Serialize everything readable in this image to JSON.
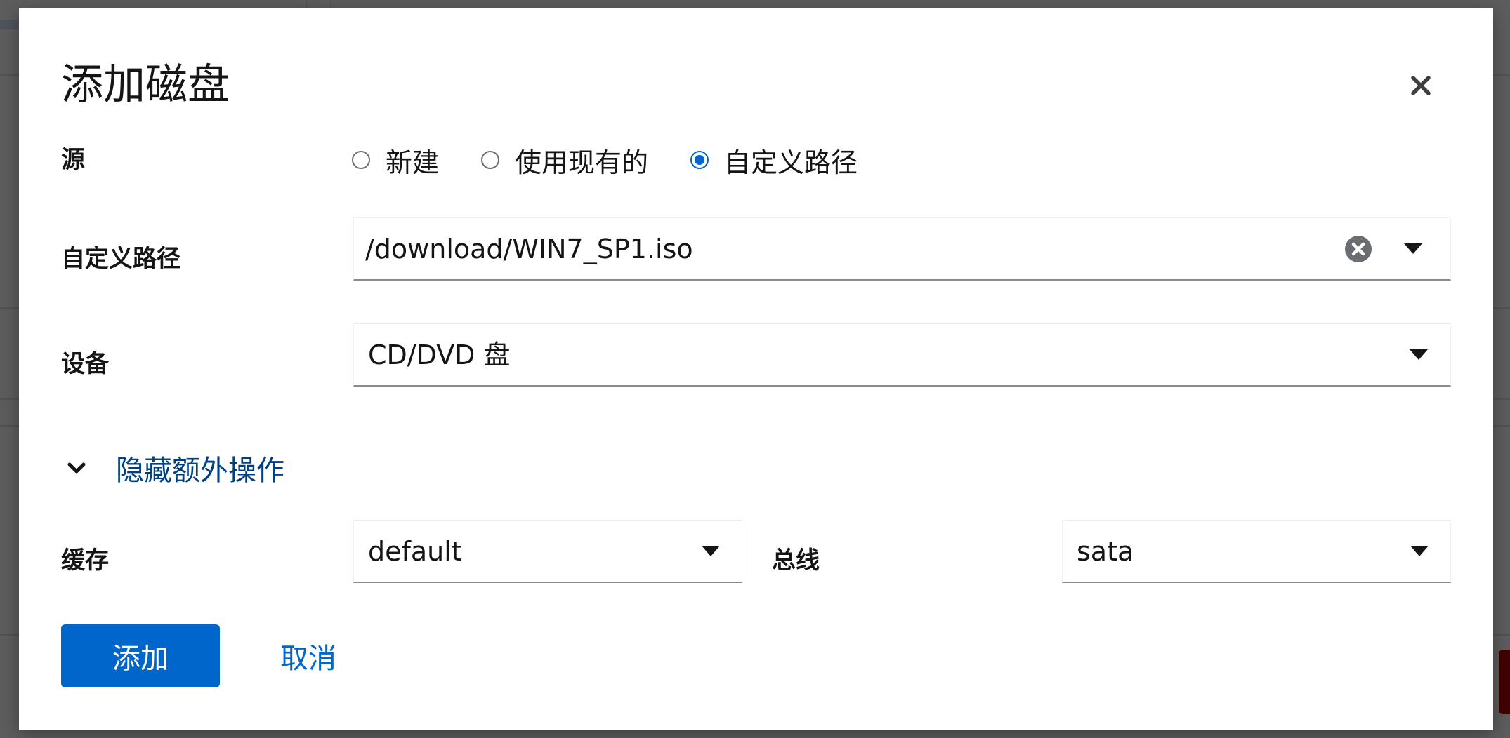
{
  "dialog": {
    "title": "添加磁盘"
  },
  "form": {
    "source": {
      "label": "源",
      "options": [
        {
          "label": "新建",
          "selected": false
        },
        {
          "label": "使用现有的",
          "selected": false
        },
        {
          "label": "自定义路径",
          "selected": true
        }
      ]
    },
    "custom_path": {
      "label": "自定义路径",
      "value": "/download/WIN7_SP1.iso"
    },
    "device": {
      "label": "设备",
      "value": "CD/DVD 盘"
    },
    "extra_toggle": {
      "label": "隐藏额外操作",
      "expanded": true
    },
    "cache": {
      "label": "缓存",
      "value": "default"
    },
    "bus": {
      "label": "总线",
      "value": "sata"
    }
  },
  "footer": {
    "add_label": "添加",
    "cancel_label": "取消"
  },
  "colors": {
    "primary": "#0066cc",
    "link": "#0066cc",
    "expand_link": "#004080",
    "text": "#151515",
    "backdrop": "#6a6e73"
  },
  "icons": {
    "close": "close-icon",
    "clear": "clear-circle-icon",
    "caret": "caret-down-icon",
    "chevron": "chevron-down-icon"
  }
}
